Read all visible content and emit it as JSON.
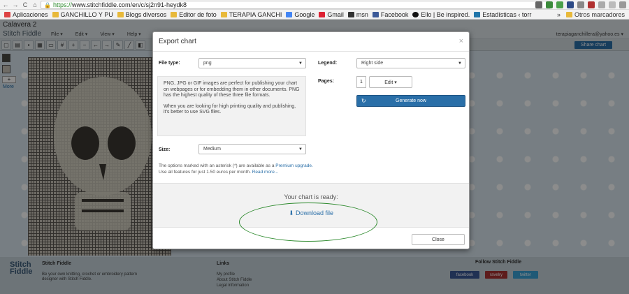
{
  "browser": {
    "url_scheme": "https://",
    "url_rest": "www.stitchfiddle.com/en/c/sj2n91-heydk8",
    "bookmarks": [
      "Aplicaciones",
      "GANCHILLO Y PU",
      "Blogs diversos",
      "Editor de foto",
      "TERAPIA GANCHI",
      "Google",
      "Gmail",
      "msn",
      "Facebook",
      "Ello | Be inspired.",
      "Estadísticas ‹ torr"
    ],
    "other_bookmarks": "Otros marcadores",
    "chevron": "»"
  },
  "app": {
    "chart_title": "Calavera 2",
    "logo": "Stitch Fiddle",
    "menus": [
      "File ▾",
      "Edit ▾",
      "View ▾",
      "Help ▾"
    ],
    "user_email": "terapiaganchillera@yahoo.es ▾",
    "share_label": "Share chart",
    "more_label": "More",
    "plus_label": "+"
  },
  "colors": {
    "accent": "#2a6fa8",
    "swatch_1": "#4a4a42",
    "swatch_2": "#c9c4b8",
    "ellipse": "#2d8a2d"
  },
  "modal": {
    "title": "Export chart",
    "close_x": "×",
    "file_type_label": "File type:",
    "file_type_value": "png",
    "info_p1": "PNG, JPG or GIF images are perfect for publishing your chart on webpages or for embedding them in other documents. PNG has the highest quality of these three file formats.",
    "info_p2": "When you are looking for high printing quality and publishing, it's better to use SVG files.",
    "size_label": "Size:",
    "size_value": "Medium",
    "legend_label": "Legend:",
    "legend_value": "Right side",
    "pages_label": "Pages:",
    "pages_value": "1",
    "edit_label": "Edit ▾",
    "generate_label": "Generate now",
    "premium_text": "The options marked with an asterisk (*) are available as a",
    "premium_link": "Premium upgrade.",
    "premium_text2": "Use all features for just 1.50 euros per month.",
    "read_more": "Read more...",
    "ready_text": "Your chart is ready:",
    "download_label": "Download file",
    "close_label": "Close"
  },
  "footer": {
    "logo_line1": "Stitch",
    "logo_line2": "Fiddle",
    "title": "Stitch Fiddle",
    "desc": "Be your own knitting, crochet or embroidery pattern designer with Stitch Fiddle.",
    "links_heading": "Links",
    "links": [
      "My profile",
      "About Stitch Fiddle",
      "Legal information"
    ],
    "follow_heading": "Follow Stitch Fiddle",
    "social": [
      "facebook",
      "ravelry",
      "twitter"
    ]
  }
}
